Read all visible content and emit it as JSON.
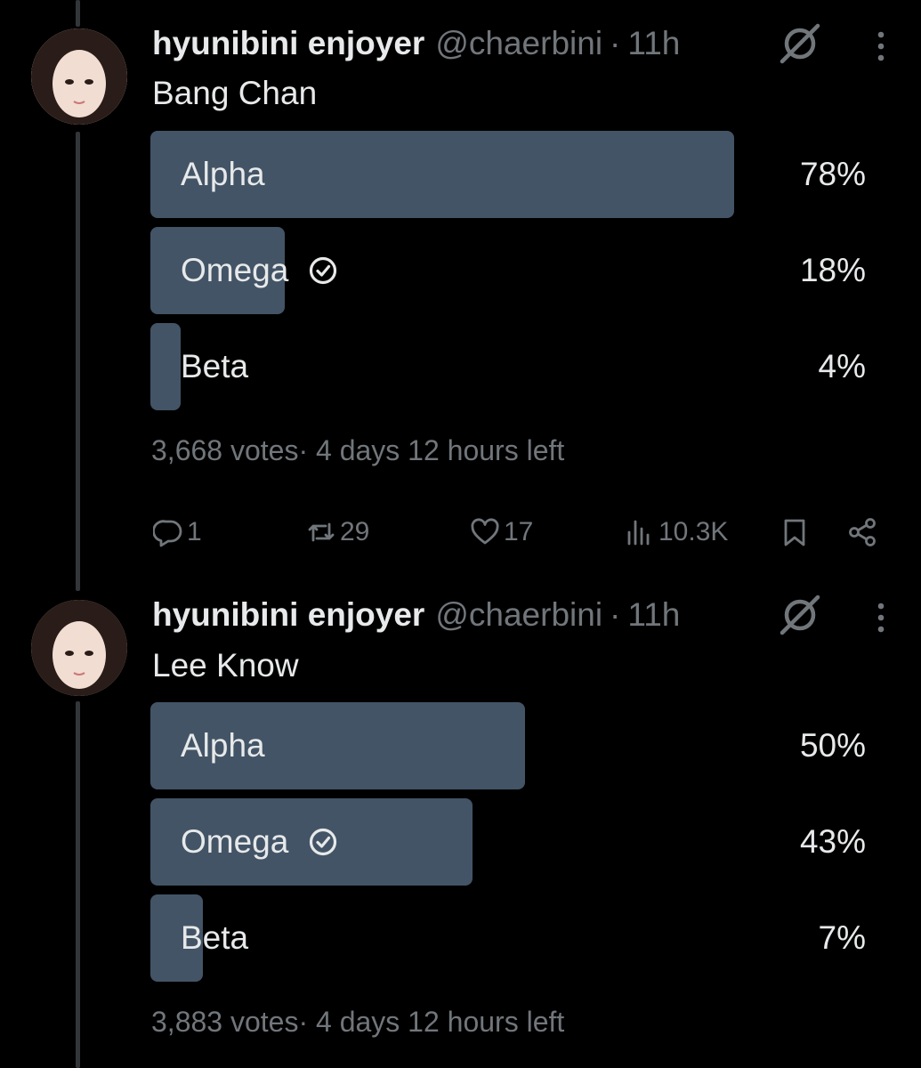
{
  "tweets": [
    {
      "author": {
        "name": "hyunibini enjoyer",
        "handle": "@chaerbini",
        "separator": "·",
        "time": "11h"
      },
      "text": "Bang Chan",
      "poll": {
        "options": [
          {
            "label": "Alpha",
            "percent_text": "78%",
            "fraction": 0.78,
            "selected": false
          },
          {
            "label": "Omega",
            "percent_text": "18%",
            "fraction": 0.18,
            "selected": true
          },
          {
            "label": "Beta",
            "percent_text": "4%",
            "fraction": 0.04,
            "selected": false
          }
        ],
        "meta": "3,668 votes· 4 days 12 hours left"
      },
      "actions": {
        "replies": "1",
        "reposts": "29",
        "likes": "17",
        "views": "10.3K"
      }
    },
    {
      "author": {
        "name": "hyunibini enjoyer",
        "handle": "@chaerbini",
        "separator": "·",
        "time": "11h"
      },
      "text": "Lee Know",
      "poll": {
        "options": [
          {
            "label": "Alpha",
            "percent_text": "50%",
            "fraction": 0.5,
            "selected": false
          },
          {
            "label": "Omega",
            "percent_text": "43%",
            "fraction": 0.43,
            "selected": true
          },
          {
            "label": "Beta",
            "percent_text": "7%",
            "fraction": 0.07,
            "selected": false
          }
        ],
        "meta": "3,883 votes· 4 days 12 hours left"
      }
    }
  ],
  "icons": {
    "grok": "grok-icon",
    "more": "more-icon",
    "check": "check-circle-icon",
    "reply": "reply-icon",
    "repost": "repost-icon",
    "like": "heart-icon",
    "views": "views-icon",
    "bookmark": "bookmark-icon",
    "share": "share-icon"
  },
  "colors": {
    "background": "#000000",
    "poll_bar": "#435466",
    "text": "#e7e9ea",
    "muted": "#71767b"
  }
}
